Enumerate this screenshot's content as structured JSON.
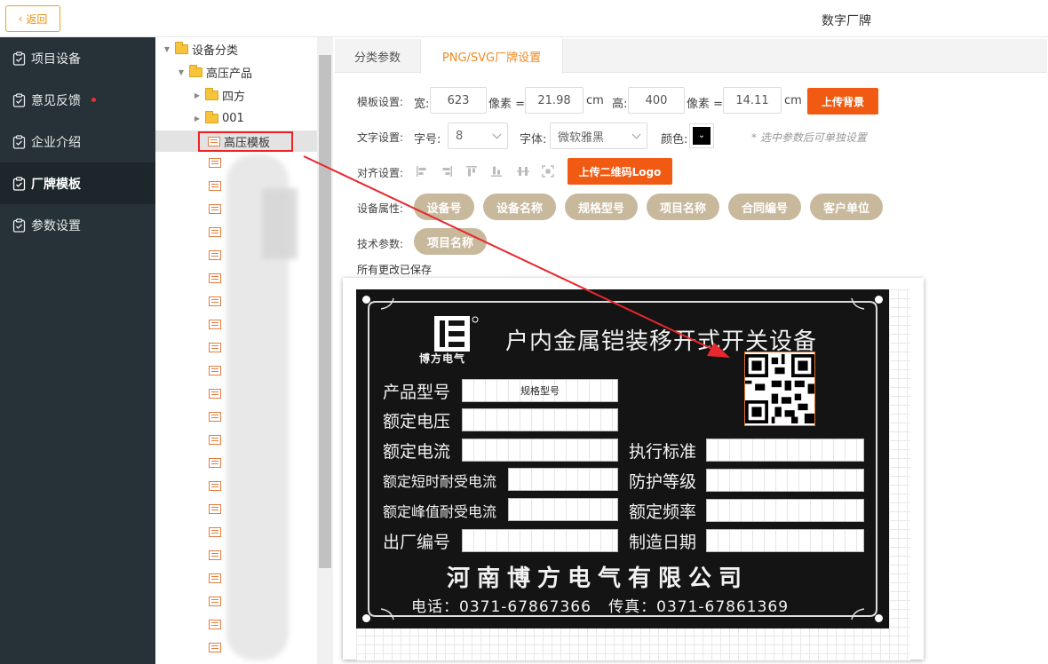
{
  "topbar": {
    "back_label": "返回",
    "title": "数字厂牌"
  },
  "sidebar": {
    "items": [
      {
        "label": "项目设备",
        "active": false
      },
      {
        "label": "意见反馈",
        "active": false,
        "badge": true
      },
      {
        "label": "企业介绍",
        "active": false
      },
      {
        "label": "厂牌模板",
        "active": true
      },
      {
        "label": "参数设置",
        "active": false
      }
    ]
  },
  "tree": {
    "root": "设备分类",
    "child": "高压产品",
    "grandchildren": [
      "四方",
      "001"
    ],
    "selected": "高压模板"
  },
  "tabs": [
    {
      "label": "分类参数",
      "active": false
    },
    {
      "label": "PNG/SVG厂牌设置",
      "active": true
    }
  ],
  "template_settings": {
    "label": "模板设置:",
    "width_label": "宽:",
    "width_px": "623",
    "px_eq": "像素 =",
    "width_cm": "21.98",
    "cm": "cm",
    "height_label": "高:",
    "height_px": "400",
    "height_cm": "14.11",
    "upload_bg": "上传背景"
  },
  "text_settings": {
    "label": "文字设置:",
    "size_label": "字号:",
    "size_value": "8",
    "font_label": "字体:",
    "font_value": "微软雅黑",
    "color_label": "颜色:",
    "color_value": "#000000",
    "hint": "* 选中参数后可单独设置"
  },
  "align_settings": {
    "label": "对齐设置:",
    "upload_qr": "上传二维码Logo"
  },
  "device_attrs": {
    "label": "设备属性:",
    "items": [
      "设备号",
      "设备名称",
      "规格型号",
      "项目名称",
      "合同编号",
      "客户单位"
    ]
  },
  "tech_params": {
    "label": "技术参数:",
    "items": [
      "项目名称"
    ]
  },
  "save_status": "所有更改已保存",
  "plate": {
    "brand": "博方电气",
    "title": "户内金属铠装移开式开关设备",
    "left_labels": [
      "产品型号",
      "额定电压",
      "额定电流",
      "额定短时耐受电流",
      "额定峰值耐受电流",
      "出厂编号"
    ],
    "right_labels": [
      "执行标准",
      "防护等级",
      "额定频率",
      "制造日期"
    ],
    "model_field_value": "规格型号",
    "company": "河南博方电气有限公司",
    "contact": "电话：0371-67867366   传真：0371-67861369"
  }
}
